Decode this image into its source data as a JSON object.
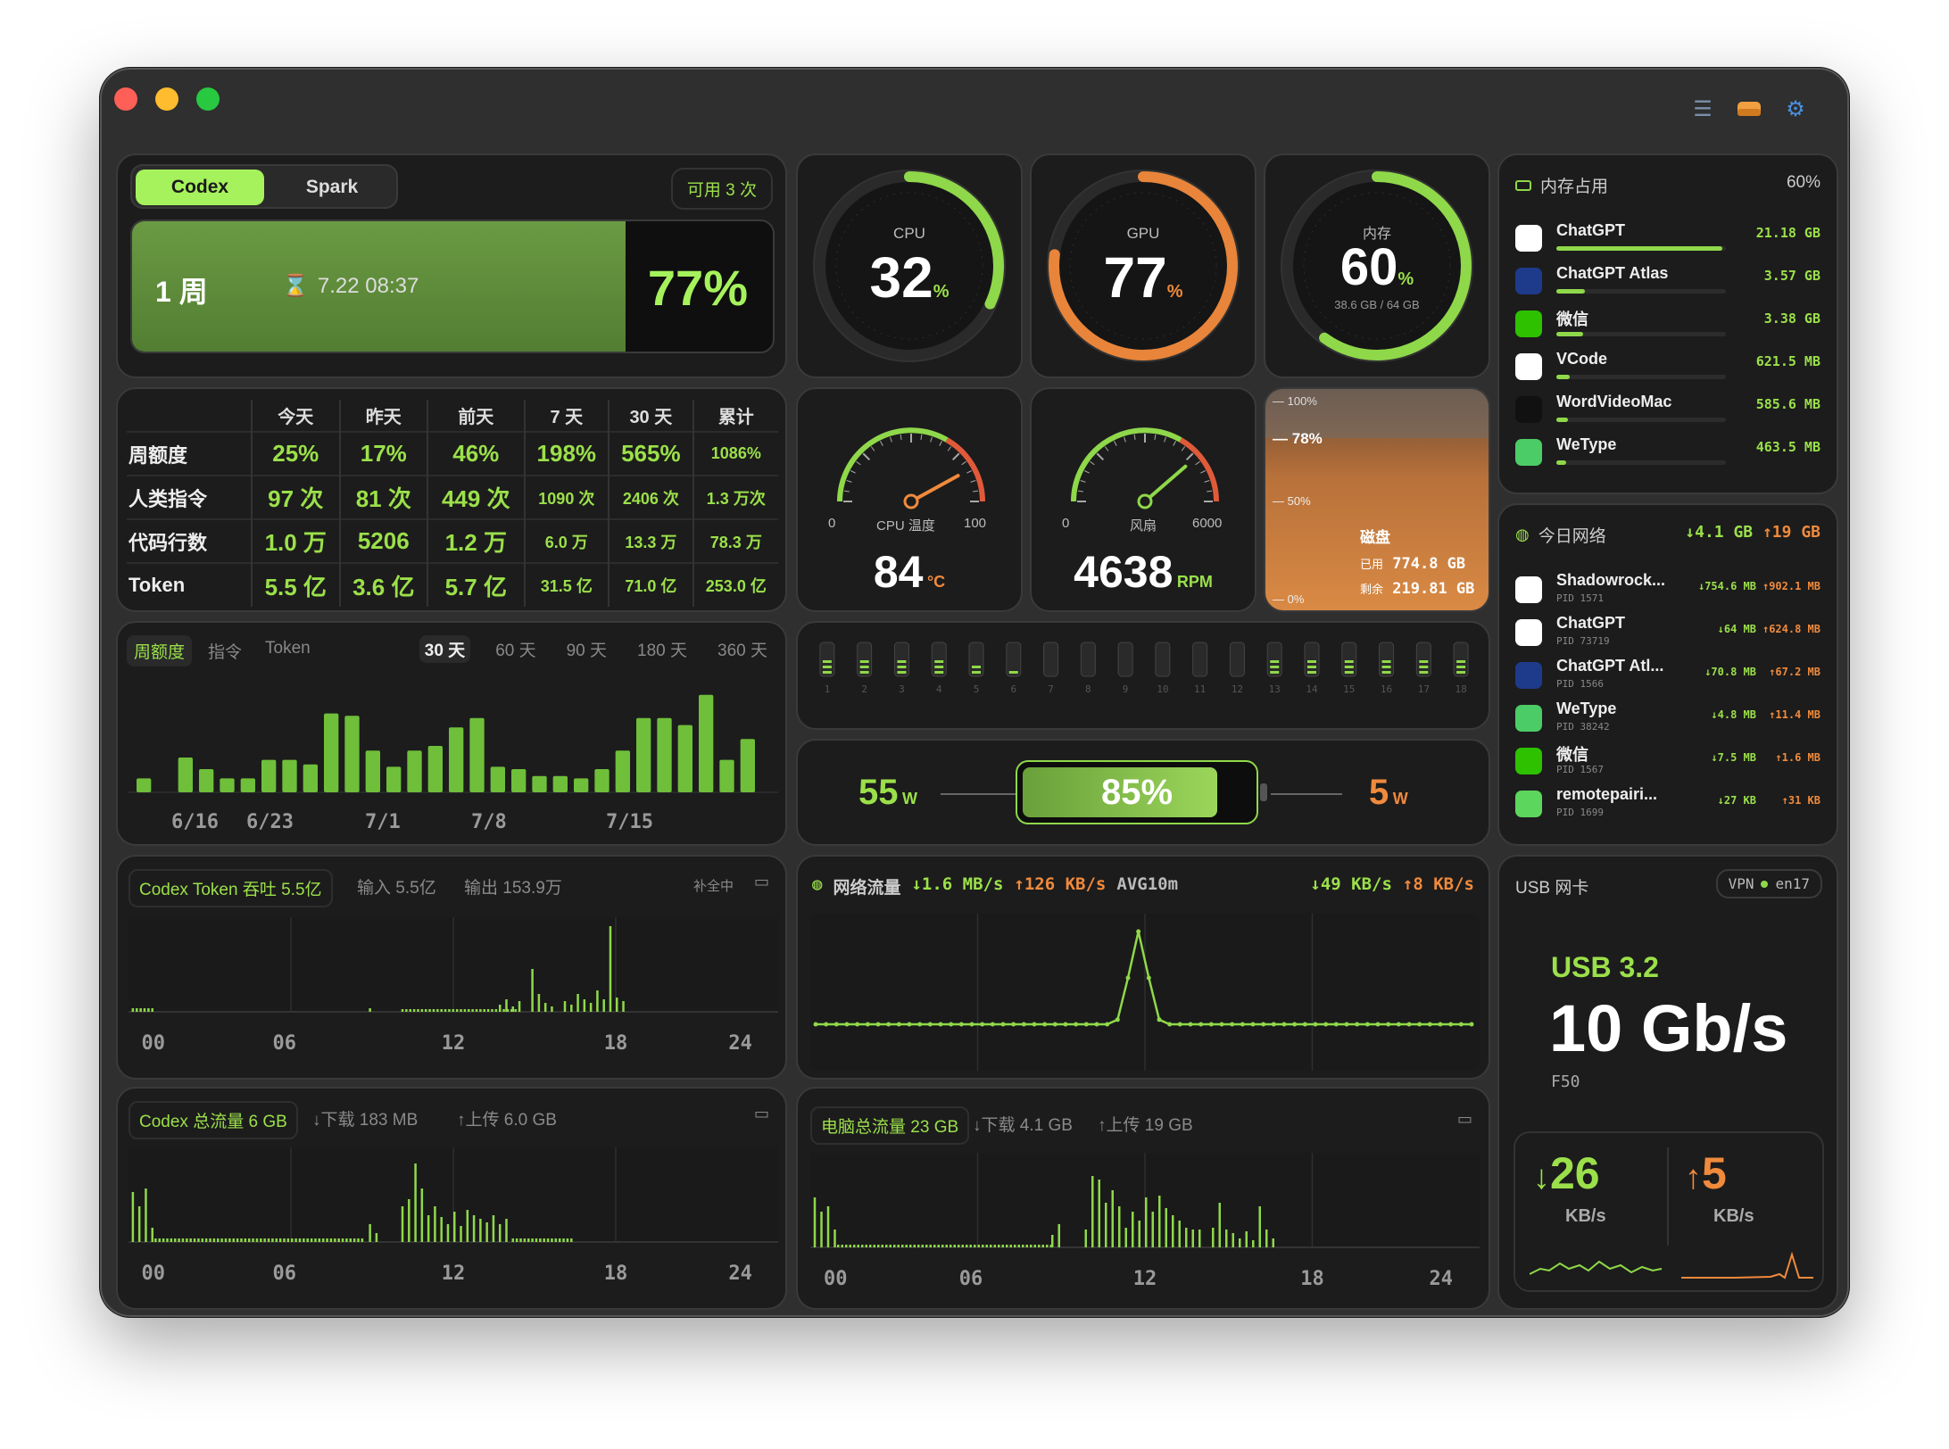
{
  "tabs": {
    "codex": "Codex",
    "spark": "Spark",
    "available": "可用 3 次"
  },
  "quota": {
    "period": "1 周",
    "reset": "7.22 08:37",
    "percent": "77%",
    "fill": 0.77
  },
  "gauges": {
    "cpu": {
      "label": "CPU",
      "value": "32",
      "unit": "%",
      "level": 0.32
    },
    "gpu": {
      "label": "GPU",
      "value": "77",
      "unit": "%",
      "level": 0.77
    },
    "mem": {
      "label": "内存",
      "value": "60",
      "unit": "%",
      "sub": "38.6 GB / 64 GB",
      "level": 0.6
    }
  },
  "temp": {
    "label": "CPU 温度",
    "min": "0",
    "max": "100",
    "value": "84",
    "unit": "°C",
    "level": 0.84
  },
  "fan": {
    "label": "风扇",
    "min": "0",
    "max": "6000",
    "value": "4638",
    "unit": "RPM",
    "level": 0.773
  },
  "disk": {
    "t100": "100%",
    "t78": "78%",
    "t50": "50%",
    "t0": "0%",
    "title": "磁盘",
    "used_label": "已用",
    "used": "774.8 GB",
    "free_label": "剩余",
    "free": "219.81 GB",
    "level": 0.78
  },
  "memory_usage": {
    "title": "内存占用",
    "percent": "60%",
    "apps": [
      {
        "name": "ChatGPT",
        "value": "21.18 GB",
        "frac": 0.98
      },
      {
        "name": "ChatGPT Atlas",
        "value": "3.57 GB",
        "frac": 0.17
      },
      {
        "name": "微信",
        "value": "3.38 GB",
        "frac": 0.16
      },
      {
        "name": "VCode",
        "value": "621.5 MB",
        "frac": 0.08
      },
      {
        "name": "WordVideoMac",
        "value": "585.6 MB",
        "frac": 0.07
      },
      {
        "name": "WeType",
        "value": "463.5 MB",
        "frac": 0.06
      }
    ]
  },
  "stats": {
    "headers": [
      "",
      "今天",
      "昨天",
      "前天",
      "7 天",
      "30 天",
      "累计"
    ],
    "rows": [
      [
        "周额度",
        "25%",
        "17%",
        "46%",
        "198%",
        "565%",
        "1086%"
      ],
      [
        "人类指令",
        "97 次",
        "81 次",
        "449 次",
        "1090 次",
        "2406 次",
        "1.3 万次"
      ],
      [
        "代码行数",
        "1.0 万",
        "5206",
        "1.2 万",
        "6.0 万",
        "13.3 万",
        "78.3 万"
      ],
      [
        "Token",
        "5.5 亿",
        "3.6 亿",
        "5.7 亿",
        "31.5 亿",
        "71.0 亿",
        "253.0 亿"
      ]
    ]
  },
  "cores": {
    "labels": [
      "1",
      "2",
      "3",
      "4",
      "5",
      "6",
      "7",
      "8",
      "9",
      "10",
      "11",
      "12",
      "13",
      "14",
      "15",
      "16",
      "17",
      "18"
    ],
    "levels": [
      0.5,
      0.45,
      0.55,
      0.4,
      0.35,
      0.2,
      0,
      0,
      0,
      0,
      0,
      0,
      0.4,
      0.5,
      0.45,
      0.5,
      0.45,
      0.4
    ]
  },
  "power": {
    "in": "55",
    "in_unit": "W",
    "battery": "85%",
    "battery_level": 0.85,
    "out": "5",
    "out_unit": "W"
  },
  "network_today": {
    "title": "今日网络",
    "down": "↓4.1 GB",
    "up": "↑19 GB",
    "procs": [
      {
        "name": "Shadowrock...",
        "pid": "PID 1571",
        "down": "↓754.6 MB",
        "up": "↑902.1 MB"
      },
      {
        "name": "ChatGPT",
        "pid": "PID 73719",
        "down": "↓64 MB",
        "up": "↑624.8 MB"
      },
      {
        "name": "ChatGPT Atl...",
        "pid": "PID 1566",
        "down": "↓70.8 MB",
        "up": "↑67.2 MB"
      },
      {
        "name": "WeType",
        "pid": "PID 38242",
        "down": "↓4.8 MB",
        "up": "↑11.4 MB"
      },
      {
        "name": "微信",
        "pid": "PID 1567",
        "down": "↓7.5 MB",
        "up": "↑1.6 MB"
      },
      {
        "name": "remotepairi...",
        "pid": "PID 1699",
        "down": "↓27 KB",
        "up": "↑31 KB"
      }
    ]
  },
  "usage_chart": {
    "tabs": [
      "周额度",
      "指令",
      "Token"
    ],
    "ranges": [
      "30 天",
      "60 天",
      "90 天",
      "180 天",
      "360 天"
    ]
  },
  "token_chart": {
    "title": "Codex Token 吞吐 5.5亿",
    "input": "输入 5.5亿",
    "output": "输出 153.9万",
    "status": "补全中"
  },
  "net_flow": {
    "title": "网络流量",
    "down": "↓1.6 MB/s",
    "up": "↑126 KB/s",
    "avg": "AVG10m",
    "down2": "↓49 KB/s",
    "up2": "↑8 KB/s"
  },
  "usb": {
    "title": "USB 网卡",
    "vpn": "VPN",
    "iface": "en17",
    "version": "USB 3.2",
    "speed": "10 Gb/s",
    "model": "F50",
    "down": "26",
    "up": "5",
    "unit": "KB/s"
  },
  "codex_traffic": {
    "title": "Codex 总流量 6 GB",
    "down": "下载 183 MB",
    "up": "上传 6.0 GB"
  },
  "pc_traffic": {
    "title": "电脑总流量 23 GB",
    "down": "下载 4.1 GB",
    "up": "上传 19 GB"
  },
  "hours": [
    "00",
    "06",
    "12",
    "18",
    "24"
  ],
  "chart_data": [
    {
      "type": "bar",
      "title": "周额度",
      "categories": [
        "6/16",
        "6/23",
        "7/1",
        "7/8",
        "7/15"
      ],
      "values": [
        0.12,
        0.0,
        0.3,
        0.2,
        0.12,
        0.12,
        0.28,
        0.28,
        0.24,
        0.68,
        0.66,
        0.36,
        0.22,
        0.36,
        0.4,
        0.56,
        0.64,
        0.22,
        0.2,
        0.14,
        0.14,
        0.12,
        0.2,
        0.36,
        0.64,
        0.64,
        0.58,
        0.84,
        0.28,
        0.46
      ]
    },
    {
      "type": "line",
      "title": "网络流量",
      "values": [
        0,
        0,
        0,
        0,
        0,
        0,
        0,
        0,
        0,
        0,
        0,
        0,
        0,
        0,
        0,
        0,
        0,
        0,
        0,
        0,
        0,
        0,
        0,
        0,
        0,
        0,
        0,
        0,
        0,
        0.05,
        0.5,
        1.0,
        0.5,
        0.05,
        0,
        0,
        0,
        0,
        0,
        0,
        0,
        0,
        0,
        0,
        0,
        0,
        0,
        0,
        0,
        0,
        0,
        0,
        0,
        0,
        0,
        0,
        0,
        0,
        0,
        0,
        0,
        0,
        0,
        0
      ]
    }
  ]
}
